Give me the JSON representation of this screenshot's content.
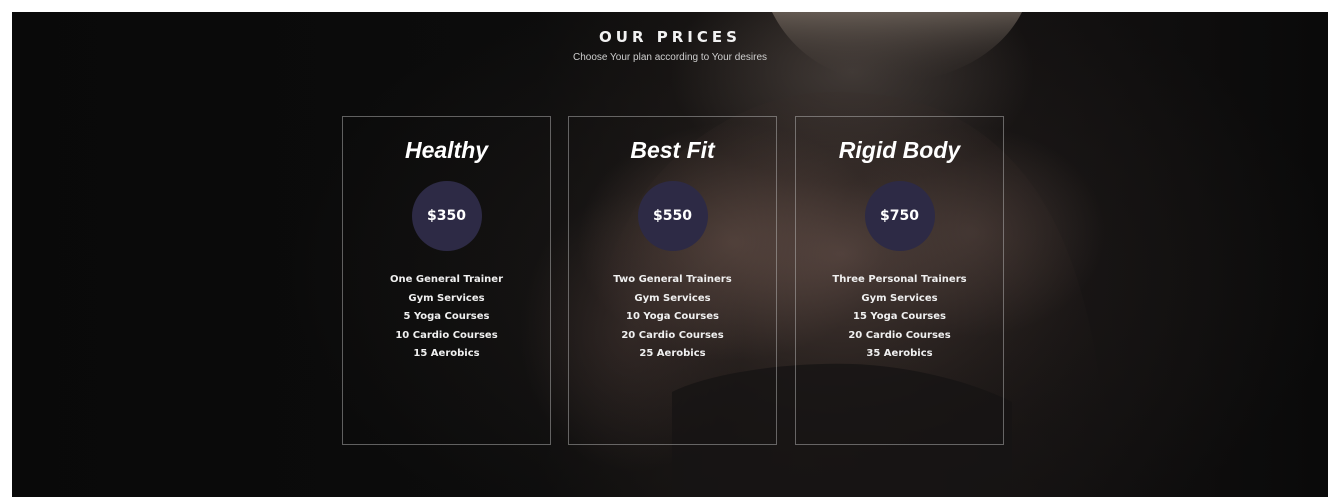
{
  "section": {
    "title": "OUR PRICES",
    "subtitle": "Choose Your plan according to Your desires"
  },
  "plans": [
    {
      "name": "Healthy",
      "price": "$350",
      "features": [
        "One General Trainer",
        "Gym Services",
        "5 Yoga Courses",
        "10 Cardio Courses",
        "15 Aerobics"
      ]
    },
    {
      "name": "Best Fit",
      "price": "$550",
      "features": [
        "Two General Trainers",
        "Gym Services",
        "10 Yoga Courses",
        "20 Cardio Courses",
        "25 Aerobics"
      ]
    },
    {
      "name": "Rigid Body",
      "price": "$750",
      "features": [
        "Three Personal Trainers",
        "Gym Services",
        "15 Yoga Courses",
        "20 Cardio Courses",
        "35 Aerobics"
      ]
    }
  ],
  "colors": {
    "background": "#0b0b0b",
    "price_circle": "#2d2a45",
    "card_border": "#8c8c8c",
    "text": "#ffffff"
  }
}
